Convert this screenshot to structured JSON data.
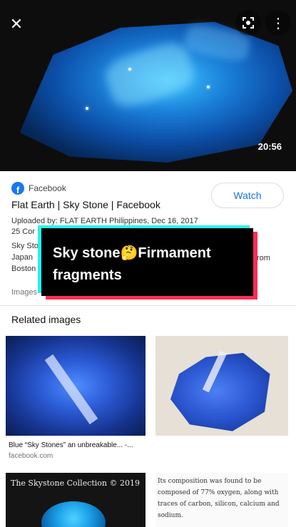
{
  "hero": {
    "duration": "20:56",
    "close_icon": "close-icon",
    "lens_icon": "lens-icon",
    "more_icon": "more-vert-icon"
  },
  "result": {
    "source": "Facebook",
    "title": "Flat Earth | Sky Stone | Facebook",
    "watch_label": "Watch",
    "uploaded": "Uploaded by: FLAT EARTH Philippines, Dec 16, 2017",
    "comments": "25 Cor",
    "desc1": "Sky Sto",
    "desc2": "Japan",
    "desc2_right": "rom",
    "desc3": "Boston",
    "images_note": "Images"
  },
  "caption": {
    "line1": "Sky stone🤔Firmament",
    "line2": "fragments"
  },
  "related": {
    "title": "Related images",
    "item1_caption": "Blue “Sky Stones” an unbreakable... -...",
    "item1_source": "facebook.com",
    "item3_text": "The Skystone Collection © 2019",
    "item4_text": "Its composition was found to be composed of 77% oxygen, along with traces of carbon, silicon, calcium and sodium."
  },
  "colors": {
    "accent_blue": "#1a73e8",
    "facebook_blue": "#1877f2",
    "caption_red": "#fe2c55",
    "caption_cyan": "#25f4ee"
  }
}
